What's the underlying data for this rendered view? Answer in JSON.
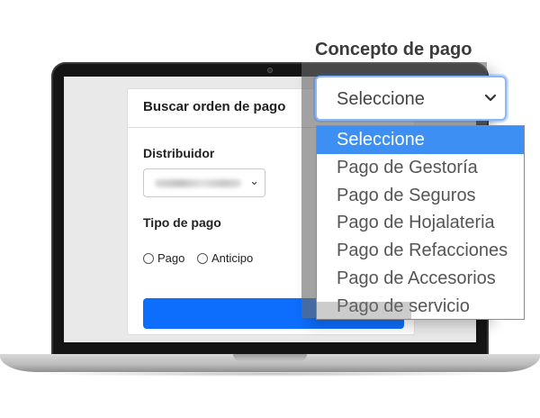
{
  "card": {
    "title": "Buscar orden de pago",
    "distribuidor_label": "Distribuidor",
    "distribuidor_value": "xxxxxxxxxx",
    "tipo_pago_label": "Tipo de pago",
    "radio_options": [
      {
        "label": "Pago",
        "selected": false
      },
      {
        "label": "Anticipo",
        "selected": false
      }
    ]
  },
  "concepto": {
    "title": "Concepto de pago",
    "selected_value": "Seleccione",
    "options": [
      {
        "label": "Seleccione",
        "selected": true
      },
      {
        "label": "Pago de Gestoría",
        "selected": false
      },
      {
        "label": "Pago de Seguros",
        "selected": false
      },
      {
        "label": "Pago de Hojalateria",
        "selected": false
      },
      {
        "label": "Pago de Refacciones",
        "selected": false
      },
      {
        "label": "Pago de Accesorios",
        "selected": false
      },
      {
        "label": "Pago de servicio",
        "selected": false
      }
    ]
  },
  "colors": {
    "primary": "#0d6efd",
    "dropdown_highlight": "#3d8ff4",
    "select_focus_border": "#8ab8f7"
  },
  "icons": {
    "select_chevron": "chevron-down-icon",
    "mini_chevron": "chevron-down-icon"
  }
}
